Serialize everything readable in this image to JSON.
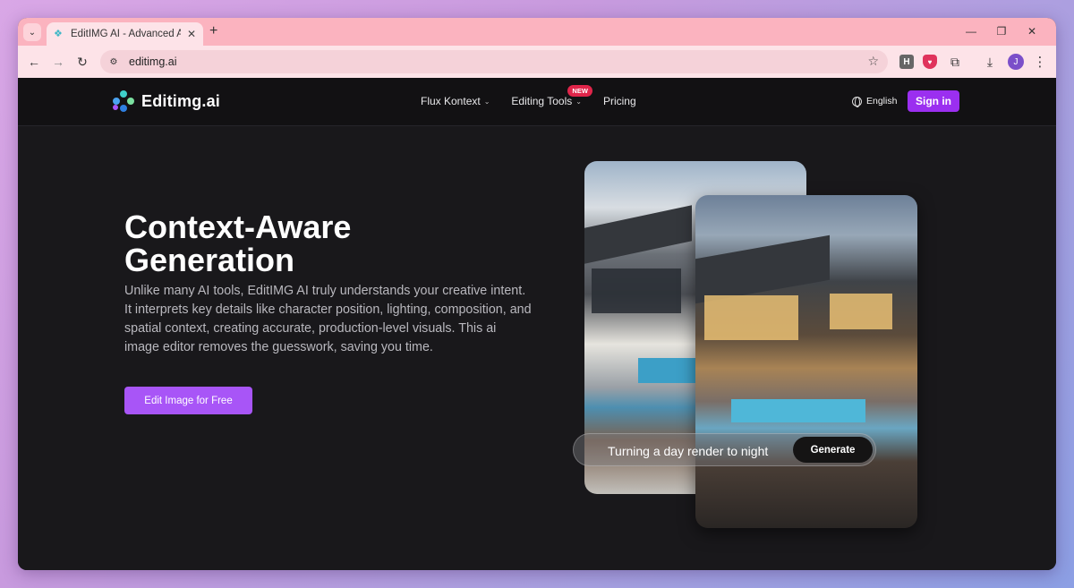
{
  "browser": {
    "tab_title": "EditIMG AI - Advanced AI Image",
    "tab_close": "✕",
    "new_tab": "+",
    "tab_dropdown": "⌄",
    "url": "editimg.ai",
    "avatar_initial": "J",
    "ext_h": "H",
    "icons": [
      "back-arrow-icon",
      "forward-arrow-icon",
      "reload-icon",
      "site-info-icon",
      "star-icon",
      "extensions-icon",
      "download-icon",
      "menu-icon",
      "minimize-icon",
      "restore-icon",
      "close-icon"
    ]
  },
  "site": {
    "logo_text": "Editimg.ai",
    "nav": [
      {
        "label": "Flux Kontext"
      },
      {
        "label": "Editing Tools",
        "badge": "NEW"
      },
      {
        "label": "Pricing"
      }
    ],
    "language": "English",
    "signin": "Sign in",
    "accent": "#9b2ff0"
  },
  "hero": {
    "title": "Context-Aware Generation",
    "description": "Unlike many AI tools, EditIMG AI truly understands your creative intent. It interprets key details like character position, lighting, composition, and spatial context, creating accurate, production-level visuals. This ai image editor removes the guesswork, saving you time.",
    "cta": "Edit Image for Free",
    "prompt": "Turning a day render to night",
    "generate": "Generate"
  }
}
